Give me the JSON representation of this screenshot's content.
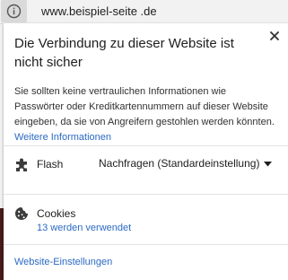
{
  "address_bar": {
    "info_icon": "info-circle-icon",
    "url": "www.beispiel-seite .de"
  },
  "popup": {
    "close_icon": "close-icon",
    "title": "Die Verbindung zu dieser Website ist nicht sicher",
    "message": "Sie sollten keine vertraulichen Informationen wie Passwörter oder Kreditkartennummern auf dieser Website eingeben, da sie von Angreifern gestohlen werden könnten.",
    "learn_more_link": "Weitere Informationen",
    "flash": {
      "icon": "puzzle-piece-icon",
      "label": "Flash",
      "selected_option": "Nachfragen (Standardeinstellung)"
    },
    "cookies": {
      "icon": "cookie-icon",
      "label": "Cookies",
      "count_link": "13 werden verwendet"
    },
    "site_settings_link": "Website-Einstellungen"
  },
  "colors": {
    "link": "#2a6ac4",
    "text": "#202020",
    "panel_background": "#ffffff",
    "chrome_background": "#f2f2f2"
  }
}
